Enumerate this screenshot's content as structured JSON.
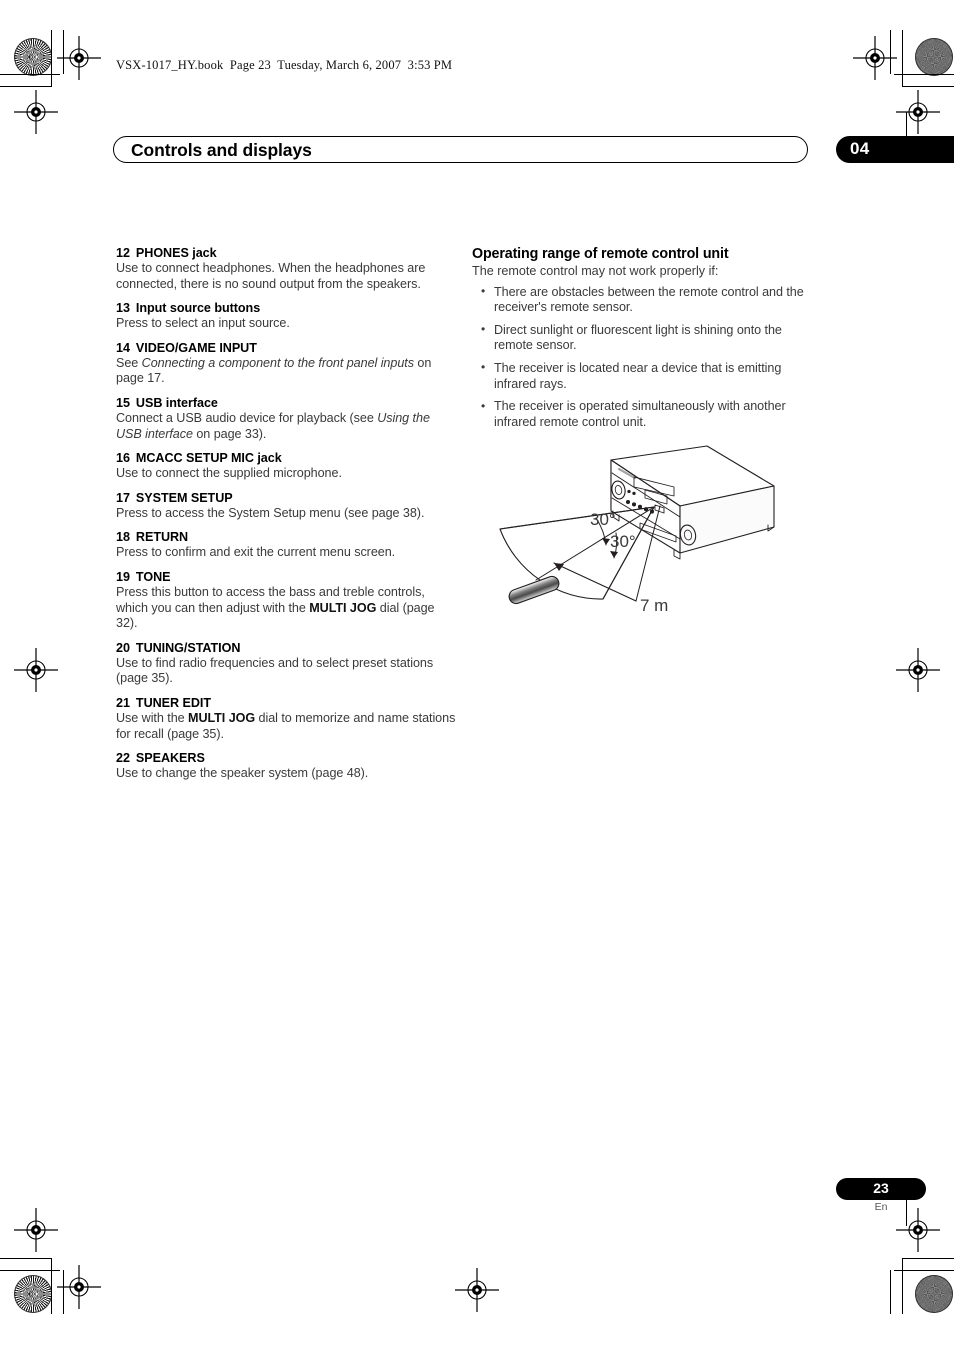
{
  "file_header": "VSX-1017_HY.book  Page 23  Tuesday, March 6, 2007  3:53 PM",
  "header": {
    "chapter_title": "Controls and displays",
    "chapter_number": "04"
  },
  "left_column": {
    "entries": [
      {
        "num": "12",
        "title": "PHONES jack",
        "body_html": "Use to connect headphones. When the headphones are connected, there is no sound output from the speakers."
      },
      {
        "num": "13",
        "title": "Input source buttons",
        "body_html": "Press to select an input source."
      },
      {
        "num": "14",
        "title": "VIDEO/GAME INPUT",
        "body_html": "See <i>Connecting a component to the front panel inputs</i> on page 17."
      },
      {
        "num": "15",
        "title": "USB interface",
        "body_html": "Connect a USB audio device for playback (see <i>Using the USB interface</i> on page 33)."
      },
      {
        "num": "16",
        "title": "MCACC SETUP MIC jack",
        "body_html": "Use to connect the supplied microphone."
      },
      {
        "num": "17",
        "title": "SYSTEM SETUP",
        "body_html": "Press to access the System Setup menu (see page 38)."
      },
      {
        "num": "18",
        "title": "RETURN",
        "body_html": "Press to confirm and exit the current menu screen."
      },
      {
        "num": "19",
        "title": "TONE",
        "body_html": "Press this button to access the bass and treble controls, which you can then adjust with the <b>MULTI JOG</b> dial (page 32)."
      },
      {
        "num": "20",
        "title": "TUNING/STATION",
        "body_html": "Use to find radio frequencies and to select preset stations (page 35)."
      },
      {
        "num": "21",
        "title": "TUNER EDIT",
        "body_html": "Use with the <b>MULTI JOG</b> dial to memorize and name stations for recall (page 35)."
      },
      {
        "num": "22",
        "title": "SPEAKERS",
        "body_html": "Use to change the speaker system (page 48)."
      }
    ]
  },
  "right_column": {
    "section_title": "Operating range of remote control unit",
    "intro": "The remote control may not work properly if:",
    "bullets": [
      "There are obstacles between the remote control and the receiver's remote sensor.",
      "Direct sunlight or fluorescent light is shining onto the remote sensor.",
      "The receiver is located near a device that is emitting infrared rays.",
      "The receiver is operated simultaneously with another infrared remote control unit."
    ],
    "figure": {
      "angle_upper": "30°",
      "angle_lower": "30°",
      "distance": "7 m"
    }
  },
  "footer": {
    "page_number": "23",
    "language": "En"
  }
}
